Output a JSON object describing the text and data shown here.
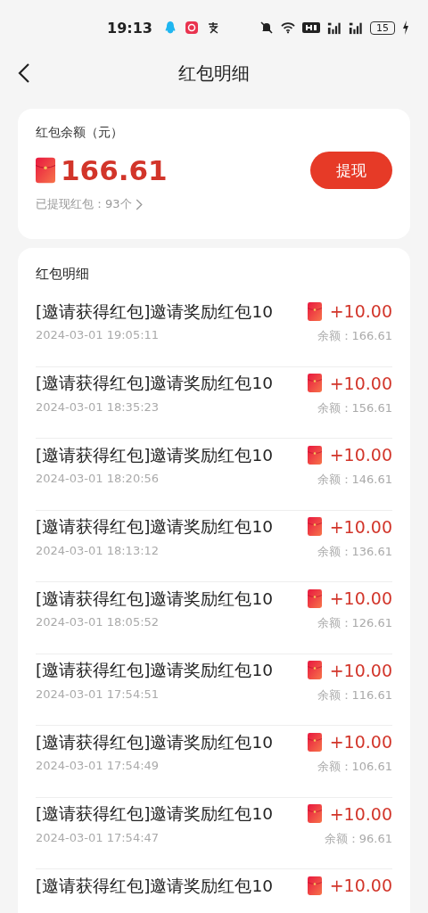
{
  "status_bar": {
    "time": "19:13",
    "battery": "15"
  },
  "header": {
    "title": "红包明细"
  },
  "balance_card": {
    "label": "红包余额（元）",
    "amount": "166.61",
    "button": "提现",
    "withdrawn": "已提现红包：93个"
  },
  "list": {
    "title": "红包明细",
    "rows": [
      {
        "title": "[邀请获得红包]邀请奖励红包10",
        "time": "2024-03-01 19:05:11",
        "amount": "+10.00",
        "balance": "余额：166.61"
      },
      {
        "title": "[邀请获得红包]邀请奖励红包10",
        "time": "2024-03-01 18:35:23",
        "amount": "+10.00",
        "balance": "余额：156.61"
      },
      {
        "title": "[邀请获得红包]邀请奖励红包10",
        "time": "2024-03-01 18:20:56",
        "amount": "+10.00",
        "balance": "余额：146.61"
      },
      {
        "title": "[邀请获得红包]邀请奖励红包10",
        "time": "2024-03-01 18:13:12",
        "amount": "+10.00",
        "balance": "余额：136.61"
      },
      {
        "title": "[邀请获得红包]邀请奖励红包10",
        "time": "2024-03-01 18:05:52",
        "amount": "+10.00",
        "balance": "余额：126.61"
      },
      {
        "title": "[邀请获得红包]邀请奖励红包10",
        "time": "2024-03-01 17:54:51",
        "amount": "+10.00",
        "balance": "余额：116.61"
      },
      {
        "title": "[邀请获得红包]邀请奖励红包10",
        "time": "2024-03-01 17:54:49",
        "amount": "+10.00",
        "balance": "余额：106.61"
      },
      {
        "title": "[邀请获得红包]邀请奖励红包10",
        "time": "2024-03-01 17:54:47",
        "amount": "+10.00",
        "balance": "余额：96.61"
      },
      {
        "title": "[邀请获得红包]邀请奖励红包10",
        "amount": "+10.00"
      }
    ]
  }
}
